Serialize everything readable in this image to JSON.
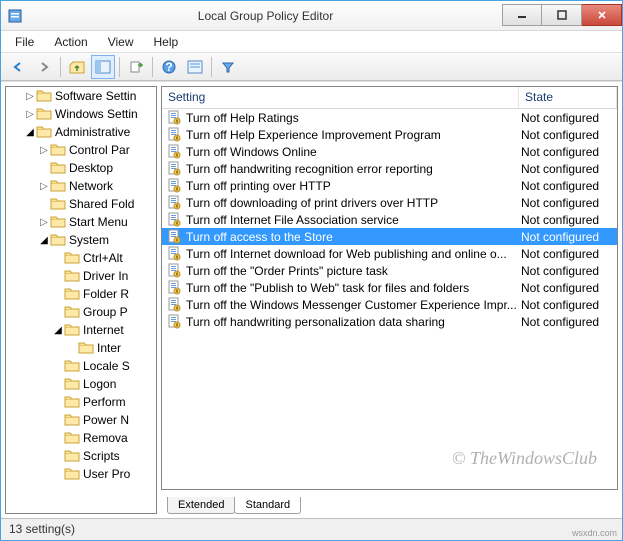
{
  "window": {
    "title": "Local Group Policy Editor"
  },
  "menu": {
    "items": [
      "File",
      "Action",
      "View",
      "Help"
    ]
  },
  "tree": {
    "nodes": [
      {
        "depth": 1,
        "tw": "r",
        "label": "Software Settin"
      },
      {
        "depth": 1,
        "tw": "r",
        "label": "Windows Settin"
      },
      {
        "depth": 1,
        "tw": "d",
        "label": "Administrative"
      },
      {
        "depth": 2,
        "tw": "r",
        "label": "Control Par"
      },
      {
        "depth": 2,
        "tw": "",
        "label": "Desktop"
      },
      {
        "depth": 2,
        "tw": "r",
        "label": "Network"
      },
      {
        "depth": 2,
        "tw": "",
        "label": "Shared Fold"
      },
      {
        "depth": 2,
        "tw": "r",
        "label": "Start Menu"
      },
      {
        "depth": 2,
        "tw": "d",
        "label": "System"
      },
      {
        "depth": 3,
        "tw": "",
        "label": "Ctrl+Alt"
      },
      {
        "depth": 3,
        "tw": "",
        "label": "Driver In"
      },
      {
        "depth": 3,
        "tw": "",
        "label": "Folder R"
      },
      {
        "depth": 3,
        "tw": "",
        "label": "Group P"
      },
      {
        "depth": 3,
        "tw": "d",
        "label": "Internet"
      },
      {
        "depth": 4,
        "tw": "",
        "label": "Inter"
      },
      {
        "depth": 3,
        "tw": "",
        "label": "Locale S"
      },
      {
        "depth": 3,
        "tw": "",
        "label": "Logon"
      },
      {
        "depth": 3,
        "tw": "",
        "label": "Perform"
      },
      {
        "depth": 3,
        "tw": "",
        "label": "Power N"
      },
      {
        "depth": 3,
        "tw": "",
        "label": "Remova"
      },
      {
        "depth": 3,
        "tw": "",
        "label": "Scripts"
      },
      {
        "depth": 3,
        "tw": "",
        "label": "User Pro"
      }
    ]
  },
  "columns": {
    "c1": "Setting",
    "c2": "State"
  },
  "settings": [
    {
      "name": "Turn off Help Ratings",
      "state": "Not configured",
      "sel": false
    },
    {
      "name": "Turn off Help Experience Improvement Program",
      "state": "Not configured",
      "sel": false
    },
    {
      "name": "Turn off Windows Online",
      "state": "Not configured",
      "sel": false
    },
    {
      "name": "Turn off handwriting recognition error reporting",
      "state": "Not configured",
      "sel": false
    },
    {
      "name": "Turn off printing over HTTP",
      "state": "Not configured",
      "sel": false
    },
    {
      "name": "Turn off downloading of print drivers over HTTP",
      "state": "Not configured",
      "sel": false
    },
    {
      "name": "Turn off Internet File Association service",
      "state": "Not configured",
      "sel": false
    },
    {
      "name": "Turn off access to the Store",
      "state": "Not configured",
      "sel": true
    },
    {
      "name": "Turn off Internet download for Web publishing and online o...",
      "state": "Not configured",
      "sel": false
    },
    {
      "name": "Turn off the \"Order Prints\" picture task",
      "state": "Not configured",
      "sel": false
    },
    {
      "name": "Turn off the \"Publish to Web\" task for files and folders",
      "state": "Not configured",
      "sel": false
    },
    {
      "name": "Turn off the Windows Messenger Customer Experience Impr...",
      "state": "Not configured",
      "sel": false
    },
    {
      "name": "Turn off handwriting personalization data sharing",
      "state": "Not configured",
      "sel": false
    }
  ],
  "tabs": {
    "t1": "Extended",
    "t2": "Standard"
  },
  "status": "13 setting(s)",
  "watermark": "© TheWindowsClub",
  "wsx": "wsxdn.com"
}
